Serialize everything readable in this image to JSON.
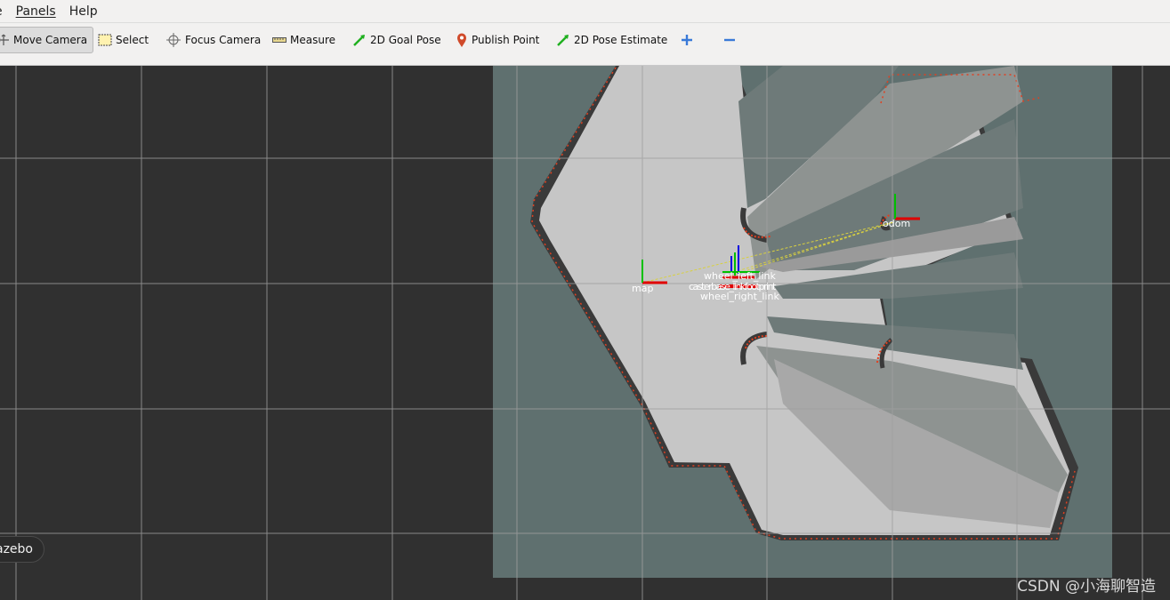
{
  "menu": {
    "items": [
      "e",
      "Panels",
      "Help"
    ]
  },
  "toolbar": {
    "tools": [
      "Move Camera",
      "Select",
      "Focus Camera",
      "Measure",
      "2D Goal Pose",
      "Publish Point",
      "2D Pose Estimate"
    ],
    "add_icon": "plus-icon",
    "remove_icon": "minus-icon"
  },
  "frames": {
    "map": "map",
    "odom": "odom",
    "wheel_left": "wheel_left_link",
    "wheel_right": "wheel_right_link",
    "base_overlap": "casterbase_linkfootprint"
  },
  "gazebo_button": "azebo",
  "watermark": "CSDN @小海聊智造",
  "colors": {
    "background": "#303030",
    "grid": "#a0a0a0",
    "map_unknown": "#5f706f",
    "map_free": "#c6c6c6",
    "map_occupied": "#3a3a3a",
    "scan_points": "#e04020",
    "axis_x": "#e00000",
    "axis_y": "#00c000",
    "axis_z": "#0000e0",
    "tf_line": "#d8d040"
  }
}
